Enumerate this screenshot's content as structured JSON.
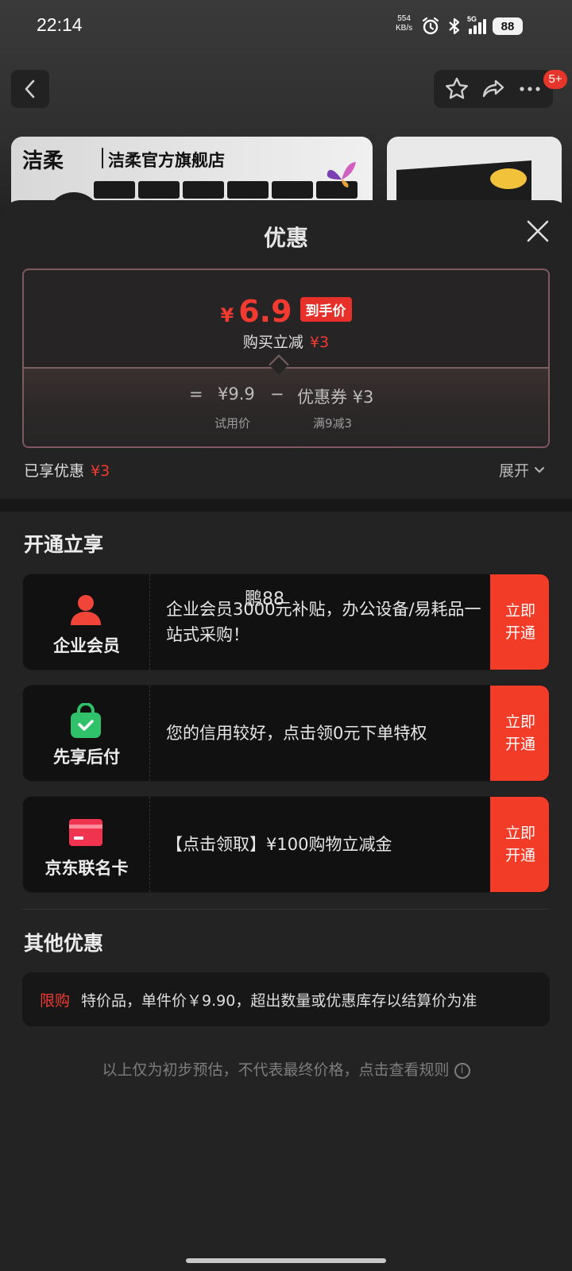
{
  "status_bar": {
    "time": "22:14",
    "net_speed_value": "554",
    "net_speed_unit": "KB/s",
    "network": "5G",
    "battery": "88"
  },
  "top_bar": {
    "message_badge": "5+"
  },
  "store": {
    "logo_text": "洁柔",
    "name": "洁柔官方旗舰店"
  },
  "sheet": {
    "title": "优惠",
    "price": {
      "currency": "¥",
      "final_price": "6.9",
      "final_label": "到手价",
      "discount_text": "购买立减",
      "discount_amount": "¥3",
      "formula": {
        "equals": "=",
        "original_price": "¥9.9",
        "minus": "−",
        "coupon_text": "优惠券 ¥3",
        "original_label": "试用价",
        "coupon_label": "满9减3"
      }
    },
    "enjoyed": {
      "label": "已享优惠",
      "amount": "¥3",
      "expand_label": "展开"
    },
    "open_section": {
      "title": "开通立享",
      "items": [
        {
          "name": "企业会员",
          "desc": "企业会员3000元补贴，办公设备/易耗品一站式采购！",
          "cta": "立即开通",
          "icon": "person-icon",
          "icon_color": "#f2453a"
        },
        {
          "name": "先享后付",
          "desc": "您的信用较好，点击领0元下单特权",
          "cta": "立即开通",
          "icon": "shopping-bag-icon",
          "icon_color": "#2fc26b"
        },
        {
          "name": "京东联名卡",
          "desc": "【点击领取】¥100购物立减金",
          "cta": "立即开通",
          "icon": "credit-card-icon",
          "icon_color": "#f0334f"
        }
      ]
    },
    "watermark": "鹏88",
    "other_section": {
      "title": "其他优惠",
      "items": [
        {
          "tag": "限购",
          "text": "特价品，单件价￥9.90，超出数量或优惠库存以结算价为准"
        }
      ]
    },
    "footer_note": "以上仅为初步预估，不代表最终价格，点击查看规则",
    "footer_icon": "i"
  },
  "colors": {
    "accent_red": "#f23a31",
    "cta_red": "#f23c28",
    "sheet_bg": "#232323"
  }
}
